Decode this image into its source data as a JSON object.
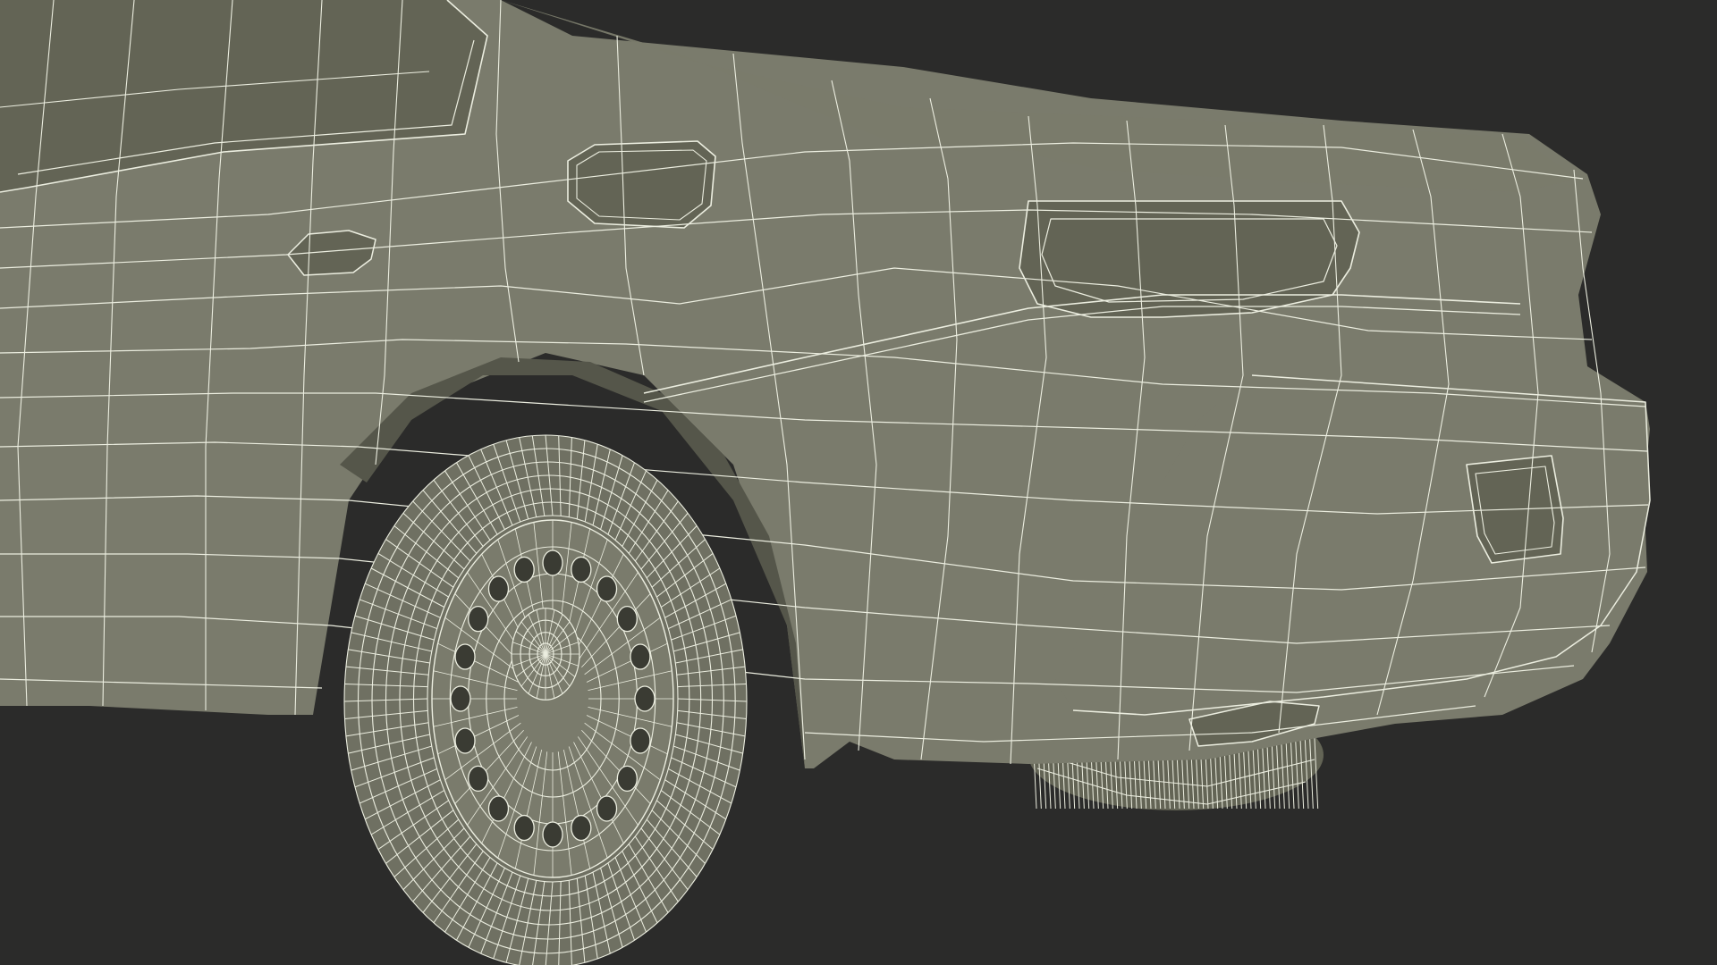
{
  "scene": {
    "subject": "car-rear-quarter-wireframe",
    "colors": {
      "background": "#2b2b2a",
      "surface": "#7a7b6c",
      "surface_dark": "#636455",
      "shadow": "#55564a",
      "wire": "#eceee0"
    },
    "wheels": [
      {
        "name": "rear-left-wheel",
        "hub_holes": 20,
        "tread_segments": 96
      },
      {
        "name": "rear-right-wheel",
        "hub_holes": 0,
        "tread_segments": 60
      }
    ]
  }
}
